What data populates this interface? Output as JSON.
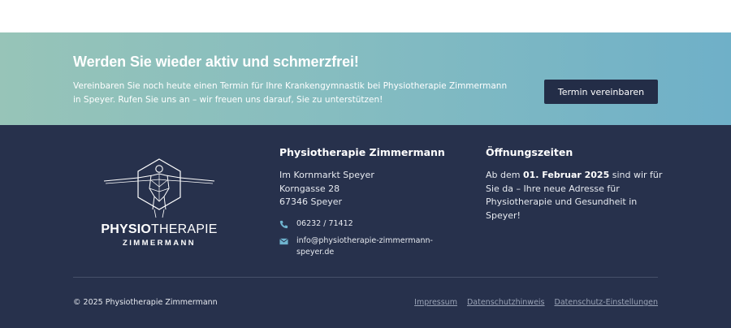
{
  "cta": {
    "title": "Werden Sie wieder aktiv und schmerzfrei!",
    "text": "Vereinbaren Sie noch heute einen Termin für Ihre Krankengymnastik bei Physiotherapie Zimmermann in Speyer. Rufen Sie uns an – wir freuen uns darauf, Sie zu unterstützen!",
    "button_label": "Termin vereinbaren"
  },
  "logo": {
    "word_bold": "PHYSIO",
    "word_regular": "THERAPIE",
    "subline": "ZIMMERMANN",
    "icon": "human-figure-hexagon-icon"
  },
  "address": {
    "heading": "Physiotherapie Zimmermann",
    "lines": [
      "Im Kornmarkt Speyer",
      "Korngasse 28",
      "67346 Speyer"
    ],
    "phone": "06232 / 71412",
    "phone_icon": "phone-icon",
    "email": "info@physiotherapie-zimmermann-speyer.de",
    "email_icon": "envelope-icon"
  },
  "hours": {
    "heading": "Öffnungszeiten",
    "prefix": "Ab dem ",
    "date": "01. Februar 2025",
    "suffix": " sind wir für Sie da – Ihre neue Adresse für Physiotherapie und Gesundheit in Speyer!"
  },
  "bottom": {
    "copyright": "© 2025 Physiotherapie Zimmermann",
    "links": [
      "Impressum",
      "Datenschutzhinweis",
      "Datenschutz-Einstellungen"
    ]
  },
  "colors": {
    "cta_gradient_start": "#97c4b8",
    "cta_gradient_end": "#6fb0c8",
    "footer_bg": "#27314c",
    "button_bg": "#232d47",
    "icon_accent": "#6fb4cf"
  }
}
